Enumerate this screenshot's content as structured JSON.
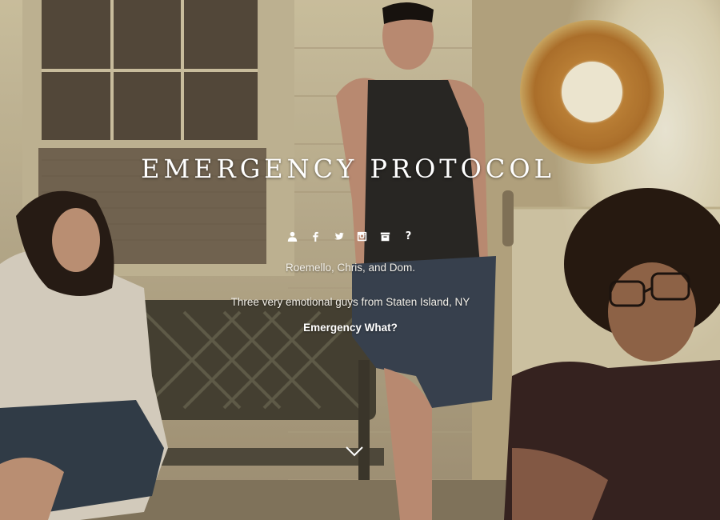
{
  "site": {
    "title": "EMERGENCY PROTOCOL"
  },
  "social_icons": [
    {
      "name": "user-icon"
    },
    {
      "name": "facebook-icon"
    },
    {
      "name": "twitter-icon"
    },
    {
      "name": "instagram-icon"
    },
    {
      "name": "archive-icon"
    },
    {
      "name": "question-icon",
      "glyph": "?"
    }
  ],
  "intro": {
    "members": "Roemello, Chris, and Dom.",
    "tagline": "Three very emotional guys from Staten Island, NY",
    "link_label": "Emergency What?"
  },
  "colors": {
    "text": "#ffffff",
    "wall": "#d8c9a6",
    "door": "#f1ead2"
  }
}
